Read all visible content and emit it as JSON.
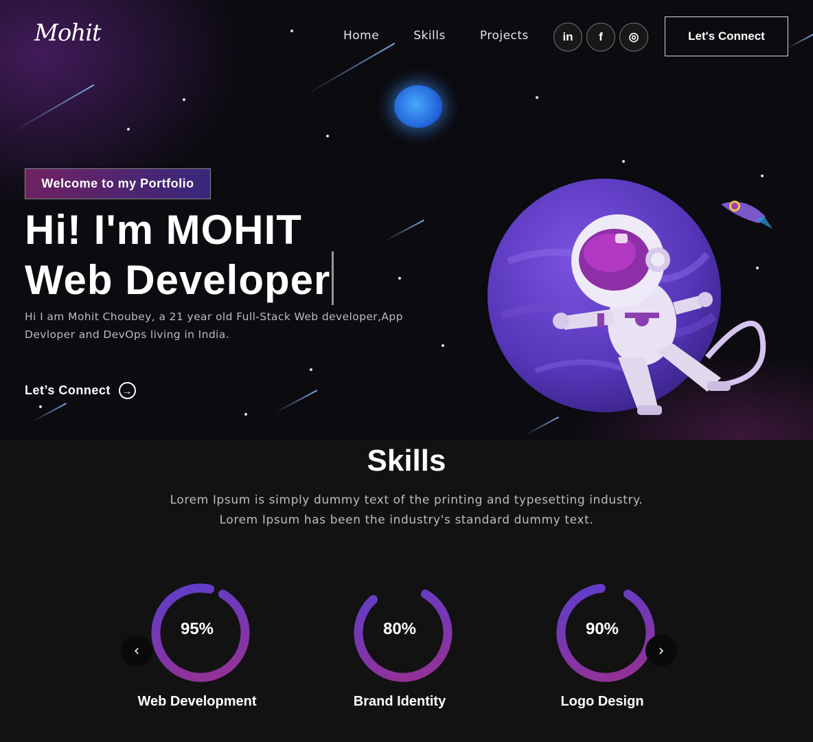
{
  "brand": {
    "logo": "Mohit"
  },
  "nav": {
    "items": [
      "Home",
      "Skills",
      "Projects"
    ]
  },
  "socials": [
    {
      "icon": "linkedin-icon",
      "glyph": "in"
    },
    {
      "icon": "facebook-icon",
      "glyph": "f"
    },
    {
      "icon": "instagram-icon",
      "glyph": "◎"
    }
  ],
  "header": {
    "cta": "Let's Connect"
  },
  "hero": {
    "badge": "Welcome to my Portfolio",
    "title_line1": "Hi! I'm MOHIT",
    "title_line2": "Web Developer",
    "description": "Hi I am Mohit Choubey, a 21 year old Full-Stack Web developer,App Devloper and DevOps living in India.",
    "cta": "Let’s Connect",
    "cta_icon": "arrow-right-circle-icon"
  },
  "skills": {
    "title": "Skills",
    "description_line1": "Lorem Ipsum is simply dummy text of the printing and typesetting industry.",
    "description_line2": "Lorem Ipsum has been the industry's standard dummy text.",
    "items": [
      {
        "label": "Web Development",
        "percent_text": "95%",
        "value": 0.95
      },
      {
        "label": "Brand Identity",
        "percent_text": "80%",
        "value": 0.8
      },
      {
        "label": "Logo Design",
        "percent_text": "90%",
        "value": 0.9
      }
    ],
    "prev_icon": "chevron-left-icon",
    "next_icon": "chevron-right-icon"
  },
  "colors": {
    "gradient_start": "#9b2f8f",
    "gradient_end": "#5a3fd0",
    "background": "#121212"
  }
}
